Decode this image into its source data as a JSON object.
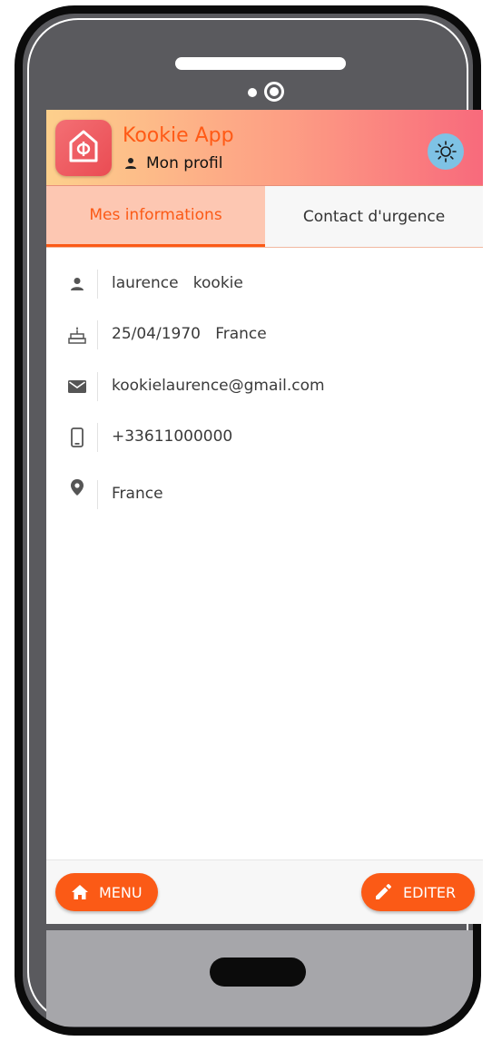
{
  "app": {
    "title": "Kookie App",
    "subtitle": "Mon profil",
    "brand_color": "#fb5a16"
  },
  "icons": {
    "logo": "app-logo-icon",
    "user": "person-icon",
    "theme": "sun-icon",
    "birthday": "cake-icon",
    "email": "envelope-icon",
    "phone": "smartphone-icon",
    "location": "map-pin-icon",
    "home": "home-icon",
    "edit": "pencil-icon"
  },
  "tabs": [
    {
      "label": "Mes informations",
      "active": true
    },
    {
      "label": "Contact d'urgence",
      "active": false
    }
  ],
  "profile": {
    "name": "laurence   kookie",
    "birth": "25/04/1970   France",
    "email": "kookielaurence@gmail.com",
    "phone": "+33611000000",
    "address": "France"
  },
  "footer": {
    "menu_label": "MENU",
    "edit_label": "EDITER"
  }
}
